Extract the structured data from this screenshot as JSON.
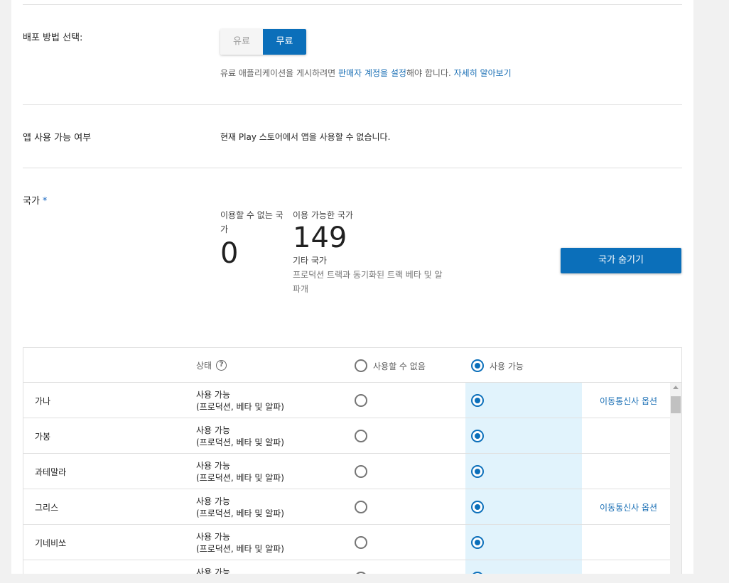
{
  "distribution": {
    "label": "배포 방법 선택:",
    "options": [
      "유료",
      "무료"
    ],
    "selected": "무료",
    "note": {
      "prefix": "유료 애플리케이션을 게시하려면 ",
      "link1": "판매자 계정을 설정",
      "middle": "해야 합니다. ",
      "link2": "자세히 알아보기"
    }
  },
  "availability": {
    "label": "앱 사용 가능 여부",
    "text": "현재 Play 스토어에서 앱을 사용할 수 없습니다."
  },
  "countries": {
    "label": "국가",
    "required_mark": "*",
    "unavailable_label": "이용할 수 없는 국가",
    "unavailable_count": "0",
    "available_label": "이용 가능한 국가",
    "available_count": "149",
    "other_label": "기타 국가",
    "other_sub": "프로덕션 트랙과 동기화된 트랙 베타 및 알파개",
    "hide_button": "국가 숨기기"
  },
  "table": {
    "header": {
      "status": "상태",
      "help_icon": "question-circle-icon",
      "unavailable": "사용할 수 없음",
      "available": "사용 가능"
    },
    "rows": [
      {
        "name": "가나",
        "status1": "사용 가능",
        "status2": "(프로덕션, 베타 및 알파)",
        "link": "이동통신사 옵션"
      },
      {
        "name": "가봉",
        "status1": "사용 가능",
        "status2": "(프로덕션, 베타 및 알파)",
        "link": ""
      },
      {
        "name": "과테말라",
        "status1": "사용 가능",
        "status2": "(프로덕션, 베타 및 알파)",
        "link": ""
      },
      {
        "name": "그리스",
        "status1": "사용 가능",
        "status2": "(프로덕션, 베타 및 알파)",
        "link": "이동통신사 옵션"
      },
      {
        "name": "기네비쏘",
        "status1": "사용 가능",
        "status2": "(프로덕션, 베타 및 알파)",
        "link": ""
      },
      {
        "name": "",
        "status1": "사용 가능",
        "status2": "",
        "link": ""
      }
    ]
  },
  "colors": {
    "accent": "#0b6fba",
    "highlight_column": "#e1f3fc",
    "link": "#1a6fb5"
  }
}
